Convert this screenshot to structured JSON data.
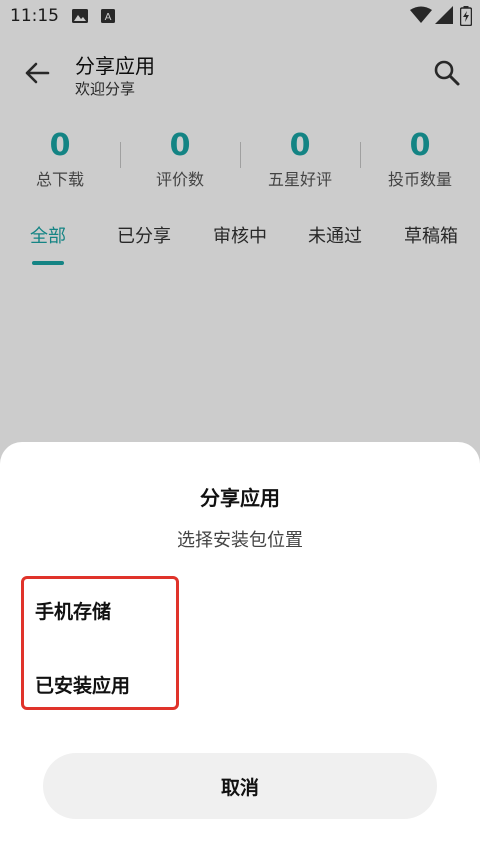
{
  "status_bar": {
    "time": "11:15",
    "icons": [
      "image-icon",
      "a-icon",
      "wifi-icon",
      "signal-icon",
      "battery-icon"
    ]
  },
  "header": {
    "title": "分享应用",
    "subtitle": "欢迎分享"
  },
  "stats": [
    {
      "value": "0",
      "label": "总下载"
    },
    {
      "value": "0",
      "label": "评价数"
    },
    {
      "value": "0",
      "label": "五星好评"
    },
    {
      "value": "0",
      "label": "投币数量"
    }
  ],
  "tabs": [
    {
      "label": "全部",
      "active": true
    },
    {
      "label": "已分享",
      "active": false
    },
    {
      "label": "审核中",
      "active": false
    },
    {
      "label": "未通过",
      "active": false
    },
    {
      "label": "草稿箱",
      "active": false
    }
  ],
  "sheet": {
    "title": "分享应用",
    "subtitle": "选择安装包位置",
    "options": [
      "手机存储",
      "已安装应用"
    ],
    "cancel_label": "取消"
  },
  "colors": {
    "accent": "#1aa6a6",
    "highlight": "#e0332a",
    "scrim": "rgba(0,0,0,0.2)"
  }
}
